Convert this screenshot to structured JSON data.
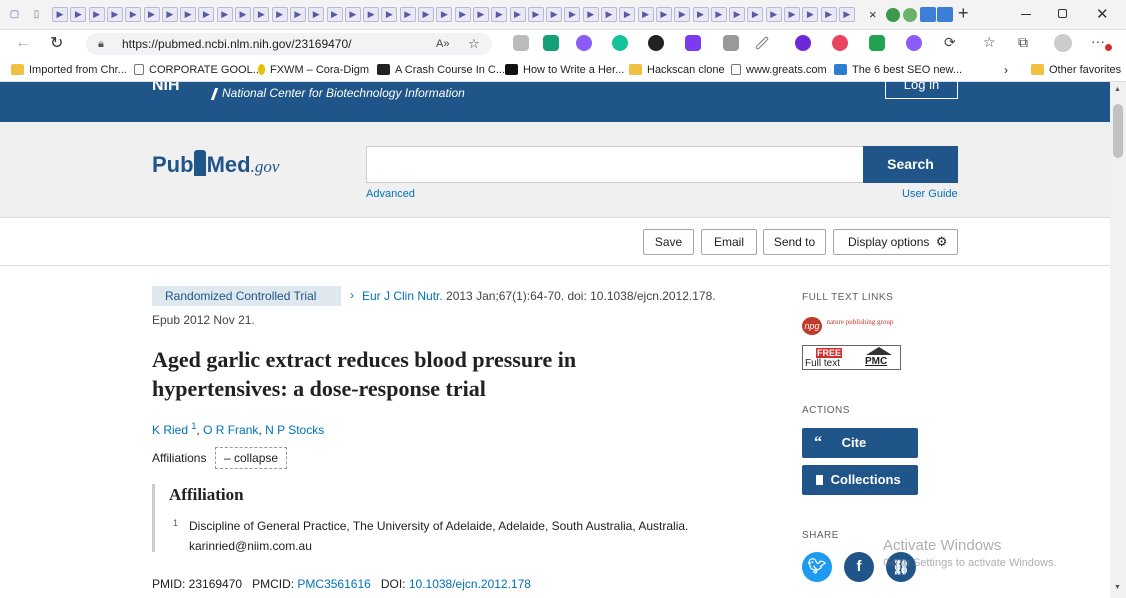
{
  "browser": {
    "url": "https://pubmed.ncbi.nlm.nih.gov/23169470/",
    "tab_close": "×",
    "new_tab": "+",
    "bookmarks": [
      {
        "label": "Imported from Chr...",
        "icon": "folder-icon"
      },
      {
        "label": "CORPORATE GOOL...",
        "icon": "page-icon"
      },
      {
        "label": "FXWM – Cora-Digm",
        "icon": "site-icon"
      },
      {
        "label": "A Crash Course In C...",
        "icon": "f-icon"
      },
      {
        "label": "How to Write a Her...",
        "icon": "c-icon"
      },
      {
        "label": "Hackscan clone",
        "icon": "folder-icon"
      },
      {
        "label": "www.greats.com",
        "icon": "page-icon"
      },
      {
        "label": "The 6 best SEO new...",
        "icon": "m-icon"
      }
    ],
    "other_favorites": "Other favorites"
  },
  "ncbi": {
    "banner": "National Center for Biotechnology Information",
    "login": "Log in"
  },
  "pubmed": {
    "logo_pub": "Pub",
    "logo_med": "Med",
    "logo_gov": ".gov",
    "search_value": "",
    "search_button": "Search",
    "advanced": "Advanced",
    "user_guide": "User Guide"
  },
  "toolbar": {
    "save": "Save",
    "email": "Email",
    "send_to": "Send to",
    "display_options": "Display options"
  },
  "article": {
    "type_badge": "Randomized Controlled Trial",
    "journal": "Eur J Clin Nutr.",
    "citation": " 2013 Jan;67(1):64-70. doi: 10.1038/ejcn.2012.178.",
    "epub": "Epub 2012 Nov 21.",
    "title_line1": "Aged garlic extract reduces blood pressure in",
    "title_line2": "hypertensives: a dose-response trial",
    "authors": [
      {
        "name": "K Ried",
        "sup": "1"
      },
      {
        "name": "O R Frank"
      },
      {
        "name": "N P Stocks"
      }
    ],
    "affiliations_label": "Affiliations",
    "collapse_label": "– collapse",
    "affiliation_heading": "Affiliation",
    "affiliation_number": "1",
    "affiliation_text_1": "Discipline of General Practice, The University of Adelaide, Adelaide, South Australia, Australia.",
    "affiliation_text_2": "karinried@niim.com.au",
    "pmid_label": "PMID: 23169470",
    "pmcid_label": "PMCID:",
    "pmcid": "PMC3561616",
    "doi_label": "DOI:",
    "doi": "10.1038/ejcn.2012.178"
  },
  "sidebar": {
    "full_text_links": "FULL TEXT LINKS",
    "npg": "npg",
    "npg_text": "nature publishing group",
    "pmc_free": "FREE",
    "pmc_full": "Full text",
    "pmc_label": "PMC",
    "actions": "ACTIONS",
    "cite": "Cite",
    "collections": "Collections",
    "share": "SHARE"
  },
  "watermark": {
    "line1": "Activate Windows",
    "line2": "Go to Settings to activate Windows."
  },
  "colors": {
    "ncbi_blue": "#20558a",
    "link": "#0071bc",
    "twitter": "#1d9bf0",
    "facebook": "#20558a",
    "link_share": "#20558a"
  }
}
